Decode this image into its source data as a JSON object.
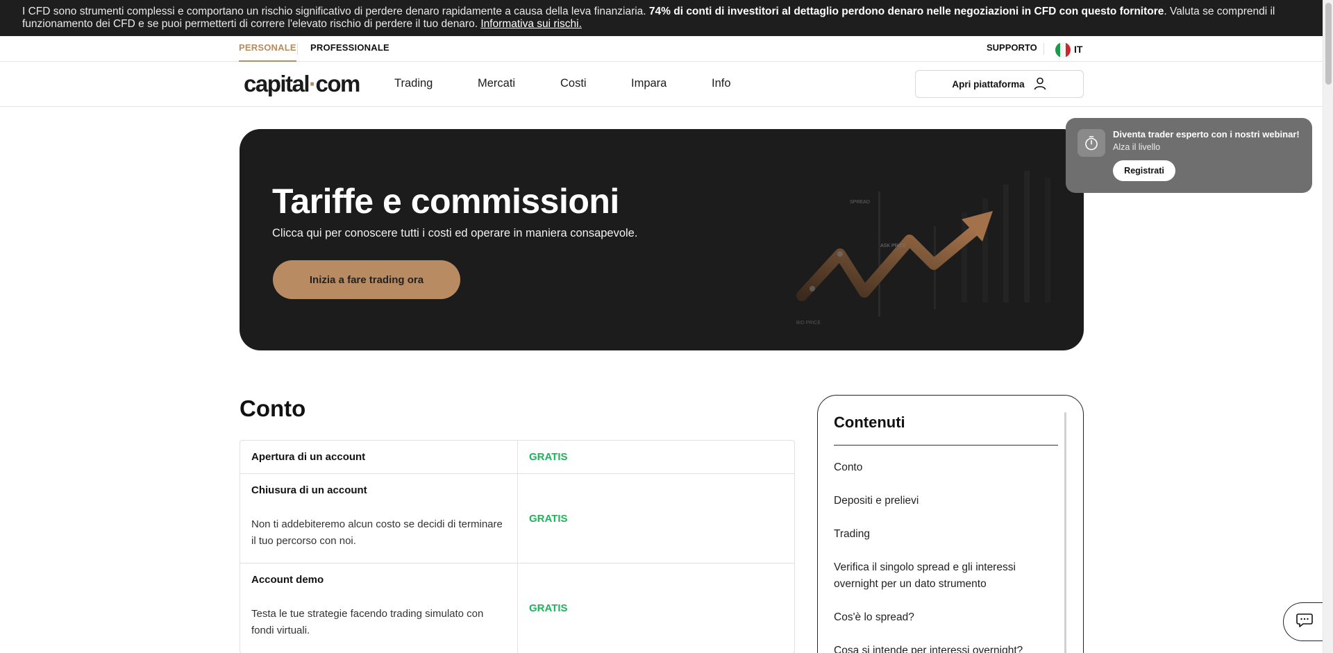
{
  "risk_banner": {
    "text_start": "I CFD sono strumenti complessi e comportano un rischio significativo di perdere denaro rapidamente a causa della leva finanziaria. ",
    "text_bold": "74% di conti di investitori al dettaglio perdono denaro nelle negoziazioni in CFD con questo fornitore",
    "text_end": ". Valuta se comprendi il funzionamento dei CFD e se puoi permetterti di correre l'elevato rischio di perdere il tuo denaro. ",
    "link": "Informativa sui rischi."
  },
  "topbar": {
    "personal": "PERSONALE",
    "professional": "PROFESSIONALE",
    "support": "SUPPORTO",
    "language": "IT"
  },
  "nav": {
    "logo_left": "capital",
    "logo_dot": "·",
    "logo_right": "com",
    "items": [
      "Trading",
      "Mercati",
      "Costi",
      "Impara",
      "Info"
    ],
    "platform_button": "Apri piattaforma"
  },
  "hero": {
    "title": "Tariffe e commissioni",
    "subtitle": "Clicca qui per conoscere tutti i costi ed operare in maniera consapevole.",
    "cta": "Inizia a fare trading ora",
    "art_labels": [
      "SPREAD",
      "ASK PRICE",
      "BID PRICE"
    ]
  },
  "toast": {
    "title": "Diventa trader esperto con i nostri webinar!",
    "subtitle": "Alza il livello",
    "button": "Registrati"
  },
  "account_section": {
    "title": "Conto",
    "rows": [
      {
        "label": "Apertura di un account",
        "description": "",
        "value": "GRATIS"
      },
      {
        "label": "Chiusura di un account",
        "description": "Non ti addebiteremo alcun costo se decidi di terminare il tuo percorso con noi.",
        "value": "GRATIS"
      },
      {
        "label": "Account demo",
        "description": "Testa le tue strategie facendo trading simulato con fondi virtuali.",
        "value": "GRATIS"
      }
    ]
  },
  "contents": {
    "title": "Contenuti",
    "items": [
      "Conto",
      "Depositi e prelievi",
      "Trading",
      "Verifica il singolo spread e gli interessi overnight per un dato strumento",
      "Cos'è lo spread?",
      "Cosa si intende per interessi overnight?"
    ]
  },
  "colors": {
    "accent": "#b88b5f",
    "free_green": "#1fb35c",
    "banner_bg": "#1e1e1e",
    "hero_bg": "#1c1c1c"
  },
  "icons": [
    "user-icon",
    "stopwatch-icon",
    "chat-icon",
    "italy-flag-icon"
  ]
}
